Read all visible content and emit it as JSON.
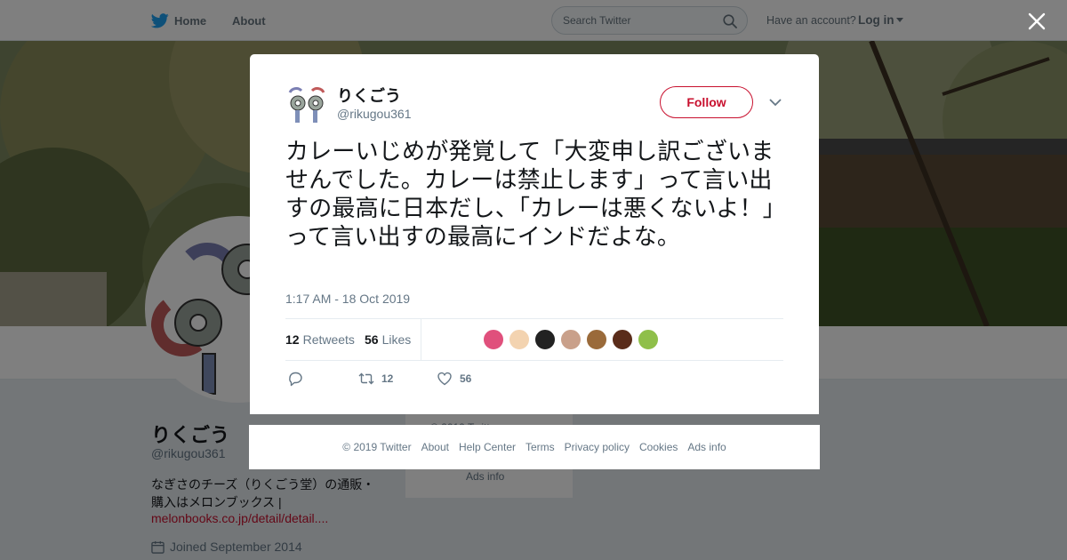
{
  "header": {
    "home_label": "Home",
    "about_label": "About",
    "search_placeholder": "Search Twitter",
    "have_account": "Have an account?",
    "login_label": "Log in"
  },
  "profile": {
    "name": "りくごう",
    "handle": "@rikugou361",
    "bio_line1": "なぎさのチーズ（りくごう堂）の通販・",
    "bio_line2": "購入はメロンブックス |",
    "link": "melonbooks.co.jp/detail/detail....",
    "joined": "Joined September 2014",
    "footer_copyright": "© 2019 Twitter",
    "footer_ads": "Ads info"
  },
  "tweet": {
    "author_name": "りくごう",
    "author_handle": "@rikugou361",
    "follow_label": "Follow",
    "text": "カレーいじめが発覚して「大変申し訳ございませんでした。カレーは禁止します」って言い出すの最高に日本だし、「カレーは悪くないよ！」って言い出すの最高にインドだよな。",
    "timestamp": "1:17 AM - 18 Oct 2019",
    "retweets_count": "12",
    "retweets_label": "Retweets",
    "likes_count": "56",
    "likes_label": "Likes",
    "action_retweet_count": "12",
    "action_like_count": "56",
    "likers": [
      "#e0507c",
      "#f3d3b0",
      "#222222",
      "#c9a08a",
      "#9a6a3a",
      "#5a2c1a",
      "#8fbf4a"
    ]
  },
  "footer": {
    "links": [
      "© 2019 Twitter",
      "About",
      "Help Center",
      "Terms",
      "Privacy policy",
      "Cookies",
      "Ads info"
    ]
  },
  "colors": {
    "accent": "#c8102e",
    "twitter_blue": "#1da1f2",
    "muted": "#657786"
  }
}
